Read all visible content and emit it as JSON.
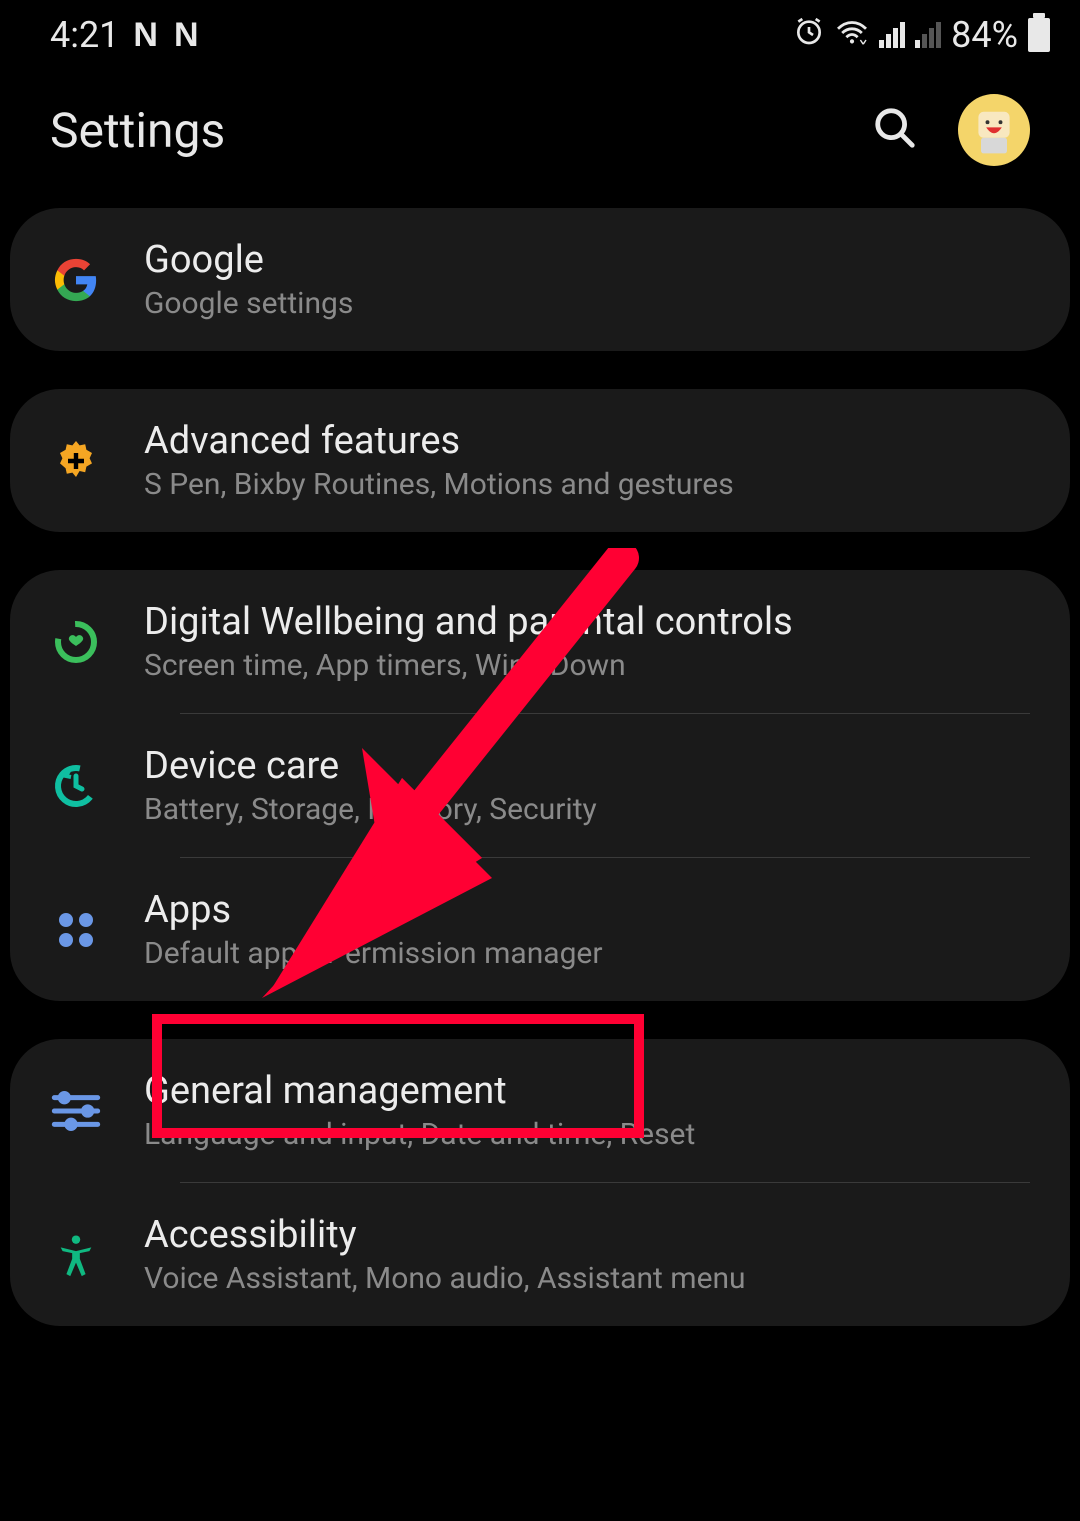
{
  "status_bar": {
    "time": "4:21",
    "notif1": "N",
    "notif2": "N",
    "battery_percent": "84%"
  },
  "header": {
    "title": "Settings"
  },
  "groups": [
    {
      "items": [
        {
          "id": "google",
          "title": "Google",
          "subtitle": "Google settings"
        }
      ]
    },
    {
      "items": [
        {
          "id": "advanced",
          "title": "Advanced features",
          "subtitle": "S Pen, Bixby Routines, Motions and gestures"
        }
      ]
    },
    {
      "items": [
        {
          "id": "wellbeing",
          "title": "Digital Wellbeing and parental controls",
          "subtitle": "Screen time, App timers, Wind Down"
        },
        {
          "id": "devicecare",
          "title": "Device care",
          "subtitle": "Battery, Storage, Memory, Security"
        },
        {
          "id": "apps",
          "title": "Apps",
          "subtitle": "Default apps, Permission manager"
        }
      ]
    },
    {
      "items": [
        {
          "id": "general",
          "title": "General management",
          "subtitle": "Language and input, Date and time, Reset"
        },
        {
          "id": "accessibility",
          "title": "Accessibility",
          "subtitle": "Voice Assistant, Mono audio, Assistant menu"
        }
      ]
    }
  ],
  "annotation": {
    "highlighted_item": "General management"
  },
  "colors": {
    "google_blue": "#4285F4",
    "gear_orange": "#f5a623",
    "wellbeing_green": "#3bbf5c",
    "devicecare_teal": "#0fbfa1",
    "apps_blue": "#6a97e6",
    "sliders_blue": "#6a97e6",
    "accessibility_green": "#10b981",
    "highlight_red": "#ff0033"
  }
}
